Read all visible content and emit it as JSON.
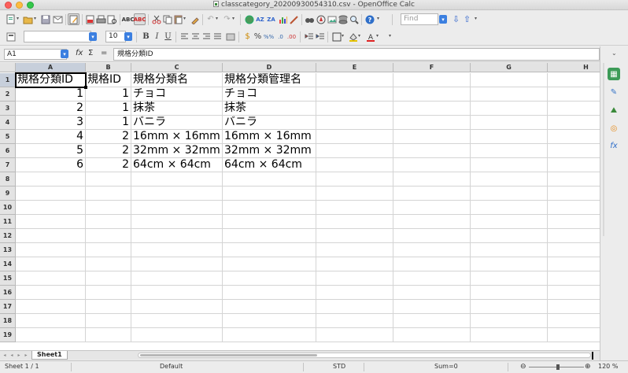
{
  "window": {
    "title": "classcategory_20200930054310.csv - OpenOffice Calc"
  },
  "toolbar": {
    "find_placeholder": "Find",
    "font_size": "10",
    "bold": "B",
    "italic": "I",
    "underline": "U",
    "percent": "%"
  },
  "formula": {
    "cell_ref": "A1",
    "content": "規格分類ID",
    "equals": "="
  },
  "grid": {
    "columns": [
      "A",
      "B",
      "C",
      "D",
      "E",
      "F",
      "G",
      "H"
    ],
    "rows": [
      "1",
      "2",
      "3",
      "4",
      "5",
      "6",
      "7",
      "8",
      "9",
      "10",
      "11",
      "12",
      "13",
      "14",
      "15",
      "16",
      "17",
      "18",
      "19"
    ],
    "header_row": [
      "規格分類ID",
      "規格ID",
      "規格分類名",
      "規格分類管理名"
    ],
    "data": [
      [
        "1",
        "1",
        "チョコ",
        "チョコ"
      ],
      [
        "2",
        "1",
        "抹茶",
        "抹茶"
      ],
      [
        "3",
        "1",
        "バニラ",
        "バニラ"
      ],
      [
        "4",
        "2",
        "16mm × 16mm",
        "16mm × 16mm"
      ],
      [
        "5",
        "2",
        "32mm × 32mm",
        "32mm × 32mm"
      ],
      [
        "6",
        "2",
        "64cm × 64cm",
        "64cm × 64cm"
      ]
    ]
  },
  "sheets": {
    "active": "Sheet1"
  },
  "status": {
    "sheet_pos": "Sheet 1 / 1",
    "page_style": "Default",
    "mode": "STD",
    "sum": "Sum=0",
    "zoom": "120 %"
  }
}
